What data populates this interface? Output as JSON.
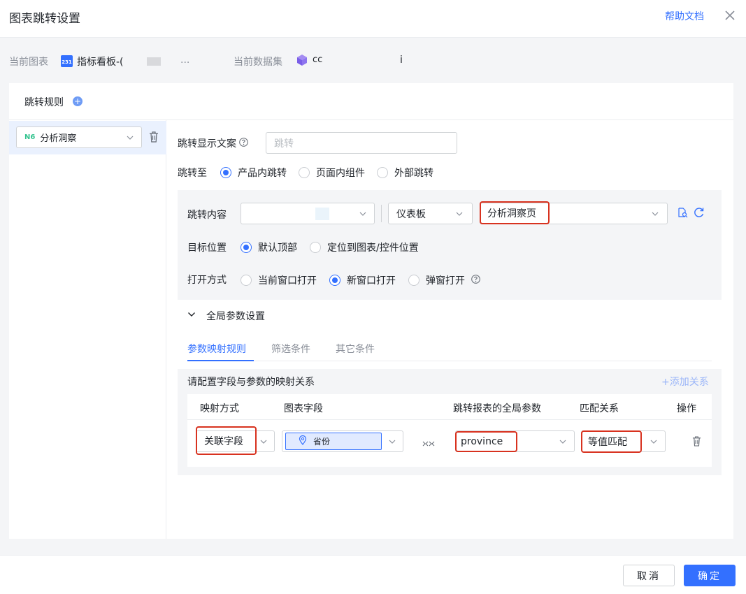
{
  "dialog": {
    "title": "图表跳转设置",
    "help_label": "帮助文档"
  },
  "info": {
    "current_chart_label": "当前图表",
    "current_chart_value": "指标看板-(",
    "current_chart_icon_text": "231",
    "current_chart_trailing": "...",
    "current_dataset_label": "当前数据集",
    "current_dataset_value": "cc",
    "current_dataset_trailing": "i"
  },
  "rules": {
    "title": "跳转规则",
    "add_icon": "+",
    "items": [
      {
        "label": "分析洞察",
        "icon_text": "N6"
      }
    ]
  },
  "form": {
    "display_text_label": "跳转显示文案",
    "display_text_placeholder": "跳转",
    "jump_to_label": "跳转至",
    "jump_to_options": [
      {
        "label": "产品内跳转",
        "selected": true
      },
      {
        "label": "页面内组件",
        "selected": false
      },
      {
        "label": "外部跳转",
        "selected": false
      }
    ],
    "content_label": "跳转内容",
    "content_select_1": "",
    "content_select_2": "仪表板",
    "content_select_3": "分析洞察页",
    "target_label": "目标位置",
    "target_options": [
      {
        "label": "默认顶部",
        "selected": true
      },
      {
        "label": "定位到图表/控件位置",
        "selected": false
      }
    ],
    "open_label": "打开方式",
    "open_options": [
      {
        "label": "当前窗口打开",
        "selected": false
      },
      {
        "label": "新窗口打开",
        "selected": true
      },
      {
        "label": "弹窗打开",
        "selected": false
      }
    ]
  },
  "global_params": {
    "section_title": "全局参数设置",
    "tabs": [
      {
        "label": "参数映射规则",
        "active": true
      },
      {
        "label": "筛选条件",
        "active": false
      },
      {
        "label": "其它条件",
        "active": false
      }
    ],
    "hint": "请配置字段与参数的映射关系",
    "add_relation": "+添加关系",
    "columns": [
      "映射方式",
      "图表字段",
      "跳转报表的全局参数",
      "匹配关系",
      "操作"
    ],
    "rows": [
      {
        "mapping_type": "关联字段",
        "chart_field": "省份",
        "global_param": "province",
        "match_relation": "等值匹配"
      }
    ]
  },
  "footer": {
    "cancel": "取消",
    "ok": "确定"
  },
  "colors": {
    "primary": "#3370ff",
    "highlight_border": "#d8321f",
    "panel_bg": "#f4f5f7"
  }
}
